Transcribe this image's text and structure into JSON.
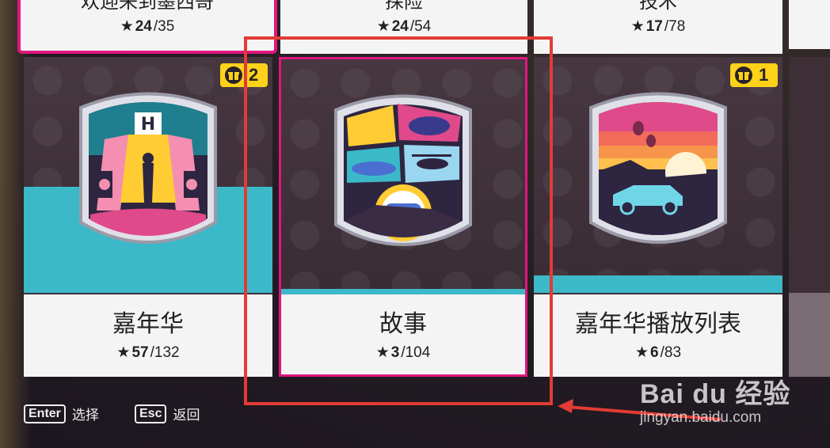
{
  "top_cards": [
    {
      "title": "欢迎来到墨西哥",
      "stars_got": "24",
      "stars_total": "/35"
    },
    {
      "title": "探险",
      "stars_got": "24",
      "stars_total": "/54"
    },
    {
      "title": "技术",
      "stars_got": "17",
      "stars_total": "/78"
    }
  ],
  "tiles": [
    {
      "name": "嘉年华",
      "stars_got": "57",
      "stars_total": "/132",
      "gift_count": "2"
    },
    {
      "name": "故事",
      "stars_got": "3",
      "stars_total": "/104"
    },
    {
      "name": "嘉年华播放列表",
      "stars_got": "6",
      "stars_total": "/83",
      "gift_count": "1"
    }
  ],
  "hints": {
    "enter_key": "Enter",
    "enter_label": "选择",
    "esc_key": "Esc",
    "esc_label": "返回"
  },
  "watermark": {
    "logo": "Bai du 经验",
    "url": "jingyan.baidu.com"
  },
  "colors": {
    "accent_pink": "#e0167f",
    "band_cyan": "#3bb9c9",
    "gift_yellow": "#ffd21a",
    "annotation_red": "#e23b36"
  }
}
